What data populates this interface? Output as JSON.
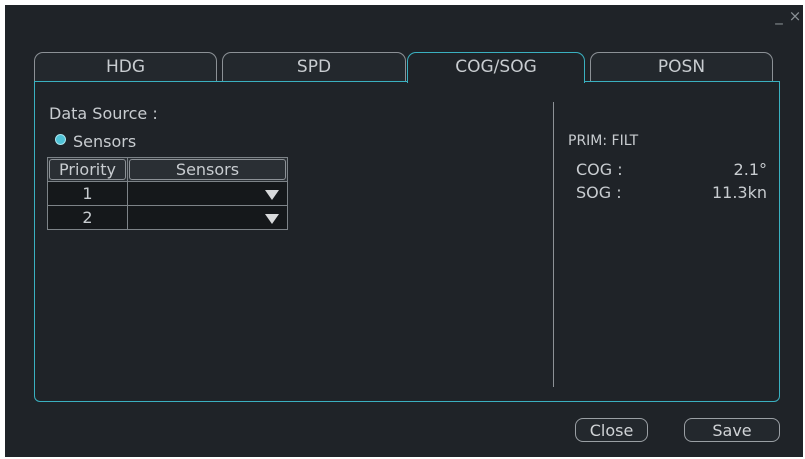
{
  "window": {
    "minimize_glyph": "_",
    "close_glyph": "×"
  },
  "tabs": [
    {
      "label": "HDG",
      "active": false
    },
    {
      "label": "SPD",
      "active": false
    },
    {
      "label": "COG/SOG",
      "active": true
    },
    {
      "label": "POSN",
      "active": false
    }
  ],
  "data_source": {
    "label": "Data Source :",
    "radio_label": "Sensors",
    "table": {
      "headers": [
        "Priority",
        "Sensors"
      ],
      "rows": [
        {
          "priority": "1",
          "sensor": ""
        },
        {
          "priority": "2",
          "sensor": ""
        }
      ]
    }
  },
  "status": {
    "mode": "PRIM:  FILT",
    "cog_label": "COG :",
    "cog_value": "2.1°",
    "sog_label": "SOG :",
    "sog_value": "11.3kn"
  },
  "buttons": {
    "close": "Close",
    "save": "Save"
  },
  "colors": {
    "accent": "#3ab0c0",
    "background": "#1f2328"
  }
}
